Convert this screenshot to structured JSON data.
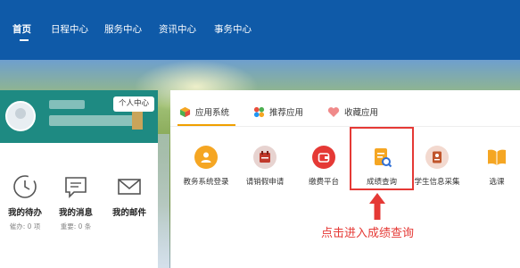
{
  "nav": {
    "items": [
      "首页",
      "日程中心",
      "服务中心",
      "资讯中心",
      "事务中心"
    ],
    "active_index": 0
  },
  "user_card": {
    "personal_center": "个人中心",
    "stats": [
      {
        "icon": "clock-icon",
        "label": "我的待办",
        "sub": "催办: 0 项"
      },
      {
        "icon": "message-icon",
        "label": "我的消息",
        "sub": "重要: 0 条"
      },
      {
        "icon": "mail-icon",
        "label": "我的邮件",
        "sub": ""
      }
    ]
  },
  "panel": {
    "tabs": [
      {
        "icon": "cube-icon",
        "label": "应用系统"
      },
      {
        "icon": "apps-icon",
        "label": "推荐应用"
      },
      {
        "icon": "heart-icon",
        "label": "收藏应用"
      }
    ],
    "apps": [
      {
        "icon": "user-shield-icon",
        "label": "教务系统登录"
      },
      {
        "icon": "calendar-request-icon",
        "label": "请销假申请"
      },
      {
        "icon": "wallet-icon",
        "label": "缴费平台"
      },
      {
        "icon": "grade-search-icon",
        "label": "成绩查询"
      },
      {
        "icon": "id-card-icon",
        "label": "学生信息采集"
      },
      {
        "icon": "book-icon",
        "label": "选课"
      }
    ]
  },
  "annotation": {
    "text": "点击进入成绩查询",
    "color": "#e53935"
  },
  "colors": {
    "nav_bg": "#0f5aa8",
    "user_header": "#1e8a82",
    "tab_accent": "#f0a000",
    "highlight": "#e53935"
  }
}
